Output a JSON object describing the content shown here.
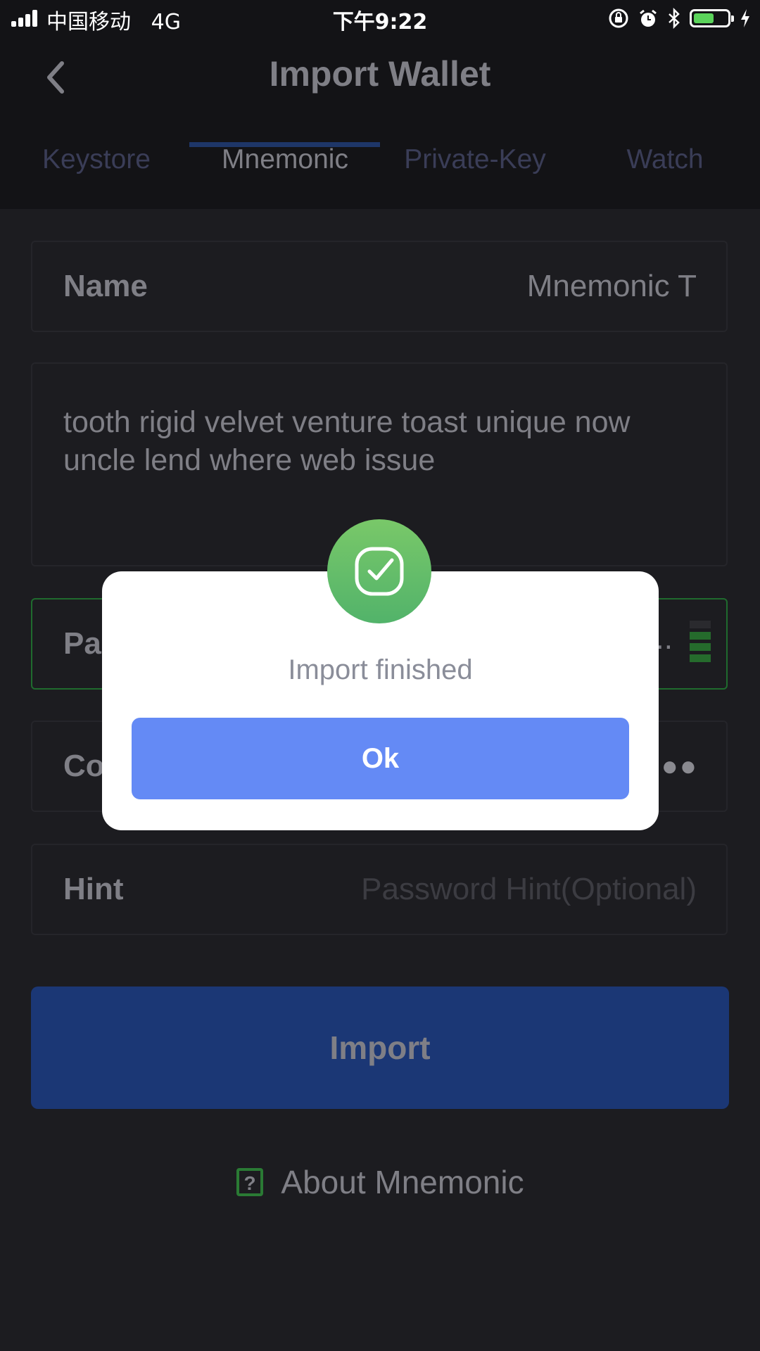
{
  "status_bar": {
    "carrier": "中国移动",
    "network": "4G",
    "time": "下午9:22",
    "icons": [
      "signal-icon",
      "orientation-lock-icon",
      "alarm-icon",
      "bluetooth-icon",
      "battery-icon",
      "charging-icon"
    ],
    "battery_level": 0.6
  },
  "header": {
    "title": "Import Wallet",
    "back_icon": "chevron-left-icon"
  },
  "tabs": [
    {
      "label": "Keystore",
      "active": false
    },
    {
      "label": "Mnemonic",
      "active": true
    },
    {
      "label": "Private-Key",
      "active": false
    },
    {
      "label": "Watch",
      "active": false
    }
  ],
  "form": {
    "name_label": "Name",
    "name_value": "Mnemonic T",
    "mnemonic": "tooth rigid velvet venture toast unique now uncle lend where web issue",
    "password_label": "Pa",
    "password_value": "..",
    "password_strength": 3,
    "confirm_label": "Co",
    "confirm_value": "●●",
    "hint_label": "Hint",
    "hint_placeholder": "Password Hint(Optional)"
  },
  "import_button": "Import",
  "about": {
    "label": "About Mnemonic",
    "icon": "help-icon"
  },
  "modal": {
    "message": "Import finished",
    "ok_label": "Ok",
    "icon": "check-icon"
  },
  "colors": {
    "background": "#1c1c20",
    "header": "#131316",
    "tab_underline": "#1e3668",
    "import_button": "#1b3775",
    "ok_button": "#648af5",
    "success_green": "#5bb76a"
  }
}
